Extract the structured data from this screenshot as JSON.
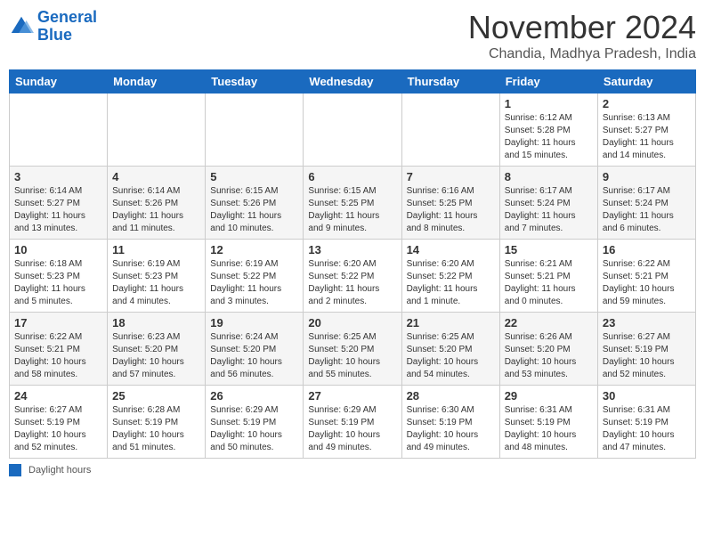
{
  "header": {
    "logo_line1": "General",
    "logo_line2": "Blue",
    "month_title": "November 2024",
    "location": "Chandia, Madhya Pradesh, India"
  },
  "days_of_week": [
    "Sunday",
    "Monday",
    "Tuesday",
    "Wednesday",
    "Thursday",
    "Friday",
    "Saturday"
  ],
  "weeks": [
    [
      {
        "day": "",
        "info": ""
      },
      {
        "day": "",
        "info": ""
      },
      {
        "day": "",
        "info": ""
      },
      {
        "day": "",
        "info": ""
      },
      {
        "day": "",
        "info": ""
      },
      {
        "day": "1",
        "info": "Sunrise: 6:12 AM\nSunset: 5:28 PM\nDaylight: 11 hours and 15 minutes."
      },
      {
        "day": "2",
        "info": "Sunrise: 6:13 AM\nSunset: 5:27 PM\nDaylight: 11 hours and 14 minutes."
      }
    ],
    [
      {
        "day": "3",
        "info": "Sunrise: 6:14 AM\nSunset: 5:27 PM\nDaylight: 11 hours and 13 minutes."
      },
      {
        "day": "4",
        "info": "Sunrise: 6:14 AM\nSunset: 5:26 PM\nDaylight: 11 hours and 11 minutes."
      },
      {
        "day": "5",
        "info": "Sunrise: 6:15 AM\nSunset: 5:26 PM\nDaylight: 11 hours and 10 minutes."
      },
      {
        "day": "6",
        "info": "Sunrise: 6:15 AM\nSunset: 5:25 PM\nDaylight: 11 hours and 9 minutes."
      },
      {
        "day": "7",
        "info": "Sunrise: 6:16 AM\nSunset: 5:25 PM\nDaylight: 11 hours and 8 minutes."
      },
      {
        "day": "8",
        "info": "Sunrise: 6:17 AM\nSunset: 5:24 PM\nDaylight: 11 hours and 7 minutes."
      },
      {
        "day": "9",
        "info": "Sunrise: 6:17 AM\nSunset: 5:24 PM\nDaylight: 11 hours and 6 minutes."
      }
    ],
    [
      {
        "day": "10",
        "info": "Sunrise: 6:18 AM\nSunset: 5:23 PM\nDaylight: 11 hours and 5 minutes."
      },
      {
        "day": "11",
        "info": "Sunrise: 6:19 AM\nSunset: 5:23 PM\nDaylight: 11 hours and 4 minutes."
      },
      {
        "day": "12",
        "info": "Sunrise: 6:19 AM\nSunset: 5:22 PM\nDaylight: 11 hours and 3 minutes."
      },
      {
        "day": "13",
        "info": "Sunrise: 6:20 AM\nSunset: 5:22 PM\nDaylight: 11 hours and 2 minutes."
      },
      {
        "day": "14",
        "info": "Sunrise: 6:20 AM\nSunset: 5:22 PM\nDaylight: 11 hours and 1 minute."
      },
      {
        "day": "15",
        "info": "Sunrise: 6:21 AM\nSunset: 5:21 PM\nDaylight: 11 hours and 0 minutes."
      },
      {
        "day": "16",
        "info": "Sunrise: 6:22 AM\nSunset: 5:21 PM\nDaylight: 10 hours and 59 minutes."
      }
    ],
    [
      {
        "day": "17",
        "info": "Sunrise: 6:22 AM\nSunset: 5:21 PM\nDaylight: 10 hours and 58 minutes."
      },
      {
        "day": "18",
        "info": "Sunrise: 6:23 AM\nSunset: 5:20 PM\nDaylight: 10 hours and 57 minutes."
      },
      {
        "day": "19",
        "info": "Sunrise: 6:24 AM\nSunset: 5:20 PM\nDaylight: 10 hours and 56 minutes."
      },
      {
        "day": "20",
        "info": "Sunrise: 6:25 AM\nSunset: 5:20 PM\nDaylight: 10 hours and 55 minutes."
      },
      {
        "day": "21",
        "info": "Sunrise: 6:25 AM\nSunset: 5:20 PM\nDaylight: 10 hours and 54 minutes."
      },
      {
        "day": "22",
        "info": "Sunrise: 6:26 AM\nSunset: 5:20 PM\nDaylight: 10 hours and 53 minutes."
      },
      {
        "day": "23",
        "info": "Sunrise: 6:27 AM\nSunset: 5:19 PM\nDaylight: 10 hours and 52 minutes."
      }
    ],
    [
      {
        "day": "24",
        "info": "Sunrise: 6:27 AM\nSunset: 5:19 PM\nDaylight: 10 hours and 52 minutes."
      },
      {
        "day": "25",
        "info": "Sunrise: 6:28 AM\nSunset: 5:19 PM\nDaylight: 10 hours and 51 minutes."
      },
      {
        "day": "26",
        "info": "Sunrise: 6:29 AM\nSunset: 5:19 PM\nDaylight: 10 hours and 50 minutes."
      },
      {
        "day": "27",
        "info": "Sunrise: 6:29 AM\nSunset: 5:19 PM\nDaylight: 10 hours and 49 minutes."
      },
      {
        "day": "28",
        "info": "Sunrise: 6:30 AM\nSunset: 5:19 PM\nDaylight: 10 hours and 49 minutes."
      },
      {
        "day": "29",
        "info": "Sunrise: 6:31 AM\nSunset: 5:19 PM\nDaylight: 10 hours and 48 minutes."
      },
      {
        "day": "30",
        "info": "Sunrise: 6:31 AM\nSunset: 5:19 PM\nDaylight: 10 hours and 47 minutes."
      }
    ]
  ],
  "legend": {
    "label": "Daylight hours"
  }
}
